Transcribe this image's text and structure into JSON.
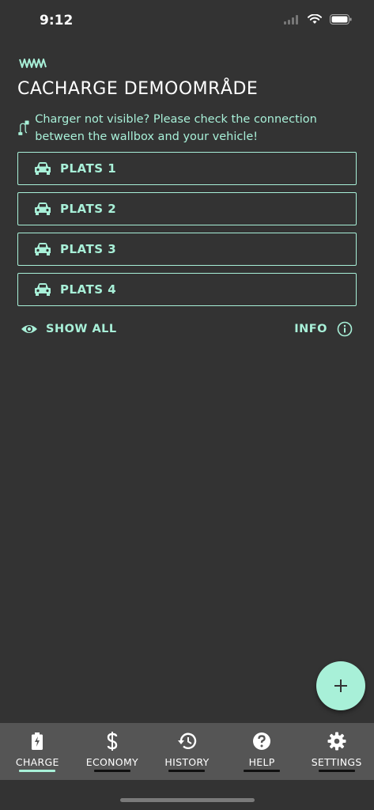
{
  "status_bar": {
    "time": "9:12",
    "icons": [
      "signal-icon",
      "wifi-icon",
      "battery-icon"
    ]
  },
  "header": {
    "logo": "coil-logo-icon",
    "title": "CACHARGE DEMOOMRÅDE"
  },
  "notice": {
    "icon": "cable-plug-icon",
    "text": "Charger not visible? Please check the connection between the wallbox and your vehicle!"
  },
  "slots": [
    {
      "label": "PLATS 1",
      "icon": "car-icon"
    },
    {
      "label": "PLATS 2",
      "icon": "car-icon"
    },
    {
      "label": "PLATS 3",
      "icon": "car-icon"
    },
    {
      "label": "PLATS 4",
      "icon": "car-icon"
    }
  ],
  "actions": {
    "show_all_label": "SHOW ALL",
    "show_all_icon": "eye-icon",
    "info_label": "INFO",
    "info_icon": "info-circle-icon"
  },
  "fab": {
    "icon": "plus-icon"
  },
  "tabs": [
    {
      "label": "CHARGE",
      "icon": "battery-charging-icon",
      "active": true
    },
    {
      "label": "ECONOMY",
      "icon": "dollar-icon",
      "active": false
    },
    {
      "label": "HISTORY",
      "icon": "history-icon",
      "active": false
    },
    {
      "label": "HELP",
      "icon": "help-circle-icon",
      "active": false
    },
    {
      "label": "SETTINGS",
      "icon": "gear-icon",
      "active": false
    }
  ],
  "colors": {
    "background": "#333333",
    "accent": "#a8f0d8",
    "tabbar": "#555555",
    "text_primary": "#ffffff"
  }
}
